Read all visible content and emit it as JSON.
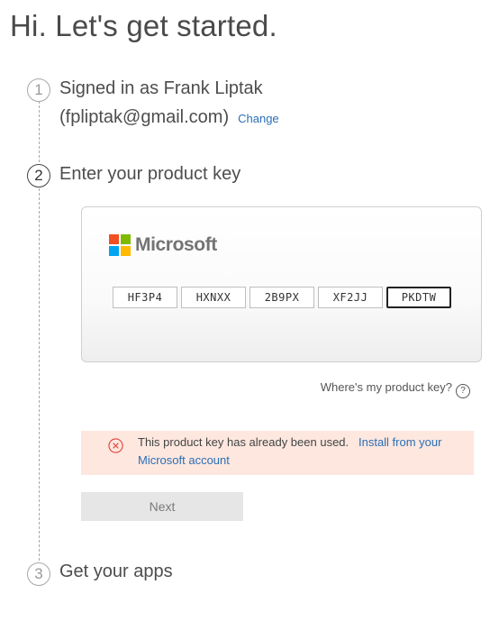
{
  "page_title": "Hi. Let's get started.",
  "steps": {
    "step1": {
      "number": "1",
      "line1": "Signed in as Frank Liptak",
      "line2": "(fpliptak@gmail.com)",
      "change_label": "Change"
    },
    "step2": {
      "number": "2",
      "title": "Enter your product key"
    },
    "step3": {
      "number": "3",
      "title": "Get your apps"
    }
  },
  "product_key_card": {
    "brand": "Microsoft",
    "logo_colors": [
      "#f25022",
      "#7fba00",
      "#00a4ef",
      "#ffb900"
    ],
    "key_segments": [
      "HF3P4",
      "HXNXX",
      "2B9PX",
      "XF2JJ",
      "PKDTW"
    ],
    "focused_segment": 4
  },
  "help_link": "Where's my product key?",
  "error": {
    "message": "This product key has already been used.",
    "link": "Install from your Microsoft account",
    "color": "#fde7df",
    "icon": "error-circle-x-icon"
  },
  "next_button": {
    "label": "Next",
    "state": "disabled"
  },
  "colors": {
    "link": "#2b6fb6",
    "error_icon": "#e0433a"
  }
}
